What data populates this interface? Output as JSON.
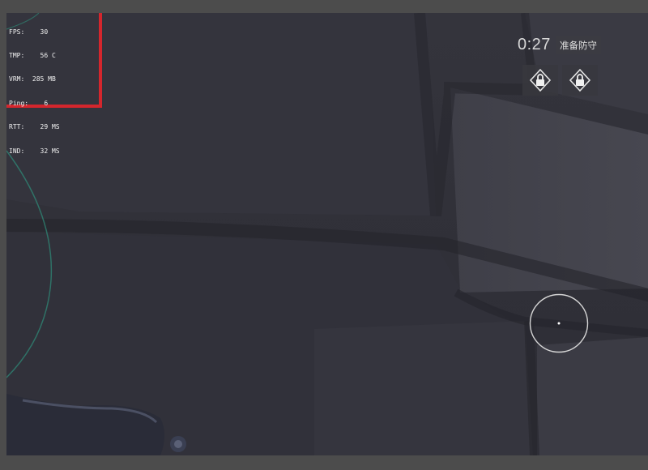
{
  "stats": [
    {
      "label": "FPS:",
      "value": "30"
    },
    {
      "label": "TMP:",
      "value": "56 C"
    },
    {
      "label": "VRM:",
      "value": "285 MB"
    },
    {
      "label": "Ping:",
      "value": "6"
    },
    {
      "label": "RTT:",
      "value": "29 MS"
    },
    {
      "label": "IND:",
      "value": "32 MS"
    }
  ],
  "hud": {
    "timer": "0:27",
    "phase": "准备防守"
  },
  "abilities": [
    {
      "icon": "lock-icon",
      "locked": true
    },
    {
      "icon": "lock-icon",
      "locked": true
    }
  ],
  "colors": {
    "stats_border": "#d4262d",
    "wall": "#33333b",
    "grass_edge": "#2f8f7a"
  }
}
